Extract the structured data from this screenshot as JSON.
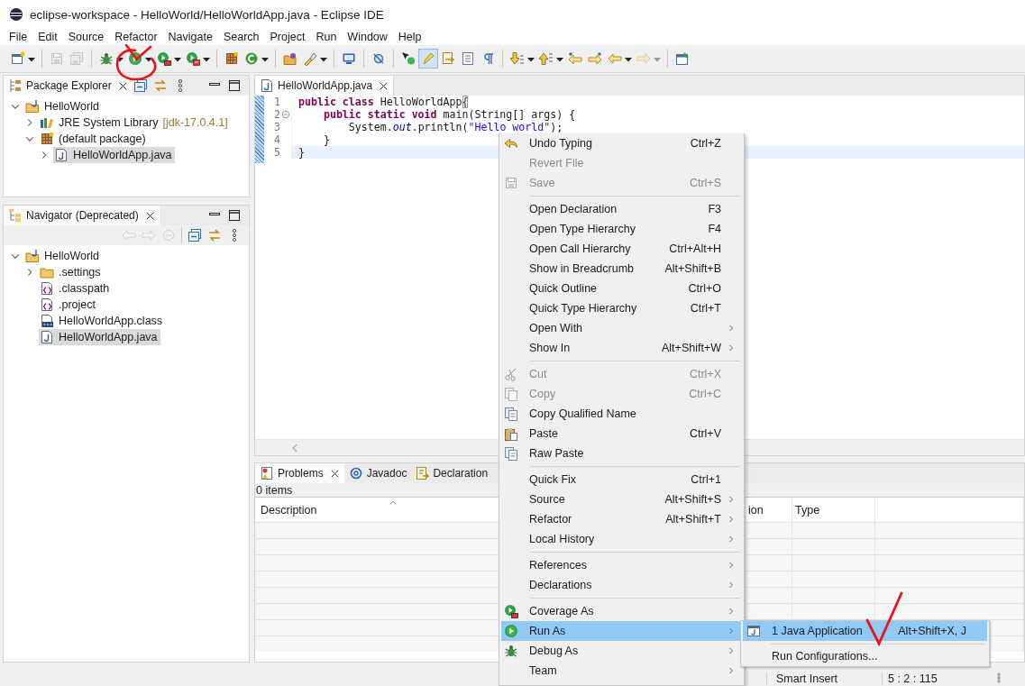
{
  "window": {
    "title": "eclipse-workspace - HelloWorld/HelloWorldApp.java - Eclipse IDE"
  },
  "menu_bar": [
    "File",
    "Edit",
    "Source",
    "Refactor",
    "Navigate",
    "Search",
    "Project",
    "Run",
    "Window",
    "Help"
  ],
  "toolbar": [
    {
      "kind": "new",
      "dropdown": true,
      "disabled": false
    },
    {
      "kind": "separator"
    },
    {
      "kind": "save",
      "disabled": true
    },
    {
      "kind": "save-all",
      "disabled": true
    },
    {
      "kind": "separator"
    },
    {
      "kind": "debug",
      "dropdown": true,
      "disabled": false
    },
    {
      "kind": "run",
      "dropdown": true,
      "disabled": false
    },
    {
      "kind": "coverage",
      "dropdown": true,
      "disabled": false
    },
    {
      "kind": "external-tools",
      "dropdown": true,
      "disabled": false
    },
    {
      "kind": "separator"
    },
    {
      "kind": "new-package",
      "disabled": false
    },
    {
      "kind": "new-class",
      "dropdown": true,
      "disabled": false
    },
    {
      "kind": "separator"
    },
    {
      "kind": "open-type",
      "disabled": false
    },
    {
      "kind": "search",
      "dropdown": true,
      "disabled": false
    },
    {
      "kind": "separator"
    },
    {
      "kind": "console",
      "disabled": false
    },
    {
      "kind": "separator"
    },
    {
      "kind": "skip-breakpoints",
      "disabled": false
    },
    {
      "kind": "separator"
    },
    {
      "kind": "breadcrumb",
      "disabled": false
    },
    {
      "kind": "mark-occurrences",
      "selected": true,
      "disabled": false
    },
    {
      "kind": "block-selection",
      "disabled": false
    },
    {
      "kind": "source-only",
      "disabled": false
    },
    {
      "kind": "whitespace",
      "disabled": false
    },
    {
      "kind": "separator"
    },
    {
      "kind": "next-annotation",
      "dropdown": true,
      "disabled": false
    },
    {
      "kind": "previous-annotation",
      "dropdown": true,
      "disabled": false
    },
    {
      "kind": "last-edit",
      "disabled": false
    },
    {
      "kind": "next-edit",
      "disabled": false
    },
    {
      "kind": "back",
      "dropdown": true,
      "disabled": false
    },
    {
      "kind": "forward",
      "dropdown": true,
      "disabled": true
    },
    {
      "kind": "separator"
    },
    {
      "kind": "perspective",
      "disabled": false
    }
  ],
  "package_explorer": {
    "tabs": [
      {
        "label": "Package Explorer",
        "kind": "package-explorer",
        "selected": true
      }
    ],
    "tree": [
      {
        "label": "HelloWorld",
        "kind": "project",
        "expanded": true,
        "selected": false,
        "children": [
          {
            "label": "JRE System Library",
            "decoration": "[jdk-17.0.4.1]",
            "kind": "library",
            "expanded": false,
            "selected": false
          },
          {
            "label": "(default package)",
            "kind": "package",
            "expanded": true,
            "selected": false,
            "children": [
              {
                "label": "HelloWorldApp.java",
                "kind": "java",
                "expanded": false,
                "selected": true
              }
            ]
          }
        ]
      }
    ]
  },
  "navigator": {
    "tabs": [
      {
        "label": "Navigator (Deprecated)",
        "kind": "navigator",
        "selected": true
      }
    ],
    "tree": [
      {
        "label": "HelloWorld",
        "kind": "project",
        "expanded": true,
        "selected": false,
        "children": [
          {
            "label": ".settings",
            "kind": "folder",
            "expanded": false,
            "selected": false
          },
          {
            "label": ".classpath",
            "kind": "settings-file",
            "selected": false
          },
          {
            "label": ".project",
            "kind": "settings-file",
            "selected": false
          },
          {
            "label": "HelloWorldApp.class",
            "kind": "class-file",
            "selected": false
          },
          {
            "label": "HelloWorldApp.java",
            "kind": "java",
            "selected": true
          }
        ]
      }
    ]
  },
  "editor": {
    "tabs": [
      {
        "label": "HelloWorldApp.java",
        "kind": "java",
        "selected": true
      }
    ],
    "lines": [
      {
        "number": "1",
        "collapsible": false,
        "current": false,
        "tokens": [
          {
            "kind": "keyword",
            "text": "public class"
          },
          {
            "kind": "plain",
            "text": " HelloWorldApp"
          },
          {
            "kind": "bracket",
            "text": "{"
          }
        ]
      },
      {
        "number": "2",
        "collapsible": true,
        "current": false,
        "tokens": [
          {
            "kind": "keyword",
            "text": "    public static void"
          },
          {
            "kind": "plain",
            "text": " main(String[] args) {"
          }
        ]
      },
      {
        "number": "3",
        "collapsible": false,
        "current": false,
        "tokens": [
          {
            "kind": "plain",
            "text": "        System."
          },
          {
            "kind": "field",
            "text": "out"
          },
          {
            "kind": "plain",
            "text": ".println("
          },
          {
            "kind": "string",
            "text": "\"Hello world\""
          },
          {
            "kind": "plain",
            "text": ");"
          }
        ]
      },
      {
        "number": "4",
        "collapsible": false,
        "current": false,
        "tokens": [
          {
            "kind": "plain",
            "text": "    }"
          }
        ]
      },
      {
        "number": "5",
        "collapsible": false,
        "current": true,
        "tokens": [
          {
            "kind": "plain",
            "text": "}"
          }
        ]
      }
    ]
  },
  "problems": {
    "tabs": [
      {
        "label": "Problems",
        "kind": "problems",
        "selected": true
      },
      {
        "label": "Javadoc",
        "kind": "javadoc",
        "selected": false
      },
      {
        "label": "Declaration",
        "kind": "declaration",
        "selected": false
      }
    ],
    "summary": "0 items",
    "columns": [
      "Description",
      "ion",
      "Type"
    ]
  },
  "status_bar": [
    "Smart Insert",
    "5 : 2 : 115"
  ],
  "context_menu": [
    {
      "kind": "undo",
      "label": "Undo Typing",
      "shortcut": "Ctrl+Z",
      "disabled": false,
      "submenu": false,
      "selected": false
    },
    {
      "kind": "plain",
      "label": "Revert File",
      "disabled": true,
      "submenu": false,
      "selected": false
    },
    {
      "kind": "save",
      "label": "Save",
      "shortcut": "Ctrl+S",
      "disabled": true,
      "submenu": false,
      "selected": false
    },
    {
      "kind": "separator"
    },
    {
      "kind": "plain",
      "label": "Open Declaration",
      "shortcut": "F3",
      "disabled": false,
      "submenu": false,
      "selected": false
    },
    {
      "kind": "plain",
      "label": "Open Type Hierarchy",
      "shortcut": "F4",
      "disabled": false,
      "submenu": false,
      "selected": false
    },
    {
      "kind": "plain",
      "label": "Open Call Hierarchy",
      "shortcut": "Ctrl+Alt+H",
      "disabled": false,
      "submenu": false,
      "selected": false
    },
    {
      "kind": "plain",
      "label": "Show in Breadcrumb",
      "shortcut": "Alt+Shift+B",
      "disabled": false,
      "submenu": false,
      "selected": false
    },
    {
      "kind": "plain",
      "label": "Quick Outline",
      "shortcut": "Ctrl+O",
      "disabled": false,
      "submenu": false,
      "selected": false
    },
    {
      "kind": "plain",
      "label": "Quick Type Hierarchy",
      "shortcut": "Ctrl+T",
      "disabled": false,
      "submenu": false,
      "selected": false
    },
    {
      "kind": "plain",
      "label": "Open With",
      "disabled": false,
      "submenu": true,
      "selected": false
    },
    {
      "kind": "plain",
      "label": "Show In",
      "shortcut": "Alt+Shift+W",
      "disabled": false,
      "submenu": true,
      "selected": false
    },
    {
      "kind": "separator"
    },
    {
      "kind": "cut",
      "label": "Cut",
      "shortcut": "Ctrl+X",
      "disabled": true,
      "submenu": false,
      "selected": false
    },
    {
      "kind": "copy",
      "label": "Copy",
      "shortcut": "Ctrl+C",
      "disabled": true,
      "submenu": false,
      "selected": false
    },
    {
      "kind": "copy",
      "label": "Copy Qualified Name",
      "disabled": false,
      "submenu": false,
      "selected": false
    },
    {
      "kind": "paste",
      "label": "Paste",
      "shortcut": "Ctrl+V",
      "disabled": false,
      "submenu": false,
      "selected": false
    },
    {
      "kind": "copy",
      "label": "Raw Paste",
      "disabled": false,
      "submenu": false,
      "selected": false
    },
    {
      "kind": "separator"
    },
    {
      "kind": "plain",
      "label": "Quick Fix",
      "shortcut": "Ctrl+1",
      "disabled": false,
      "submenu": false,
      "selected": false
    },
    {
      "kind": "plain",
      "label": "Source",
      "shortcut": "Alt+Shift+S",
      "disabled": false,
      "submenu": true,
      "selected": false
    },
    {
      "kind": "plain",
      "label": "Refactor",
      "shortcut": "Alt+Shift+T",
      "disabled": false,
      "submenu": true,
      "selected": false
    },
    {
      "kind": "plain",
      "label": "Local History",
      "disabled": false,
      "submenu": true,
      "selected": false
    },
    {
      "kind": "separator"
    },
    {
      "kind": "plain",
      "label": "References",
      "disabled": false,
      "submenu": true,
      "selected": false
    },
    {
      "kind": "plain",
      "label": "Declarations",
      "disabled": false,
      "submenu": true,
      "selected": false
    },
    {
      "kind": "separator"
    },
    {
      "kind": "coverage",
      "label": "Coverage As",
      "disabled": false,
      "submenu": true,
      "selected": false
    },
    {
      "kind": "run",
      "label": "Run As",
      "disabled": false,
      "submenu": true,
      "selected": true
    },
    {
      "kind": "debug",
      "label": "Debug As",
      "disabled": false,
      "submenu": true,
      "selected": false
    },
    {
      "kind": "plain",
      "label": "Team",
      "disabled": false,
      "submenu": true,
      "selected": false
    }
  ],
  "submenu": [
    {
      "kind": "java-app",
      "label": "1 Java Application",
      "shortcut": "Alt+Shift+X, J",
      "disabled": false,
      "submenu": false,
      "selected": true
    },
    {
      "kind": "separator"
    },
    {
      "kind": "plain",
      "label": "Run Configurations...",
      "disabled": false,
      "submenu": false,
      "selected": false
    }
  ]
}
